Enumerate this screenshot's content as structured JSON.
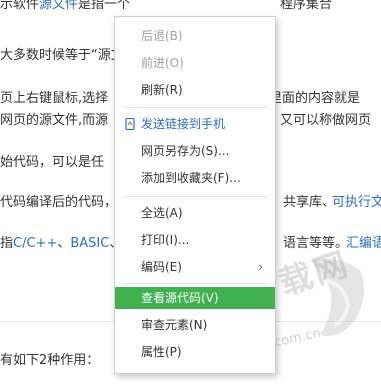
{
  "article": {
    "line1_a": "示软件",
    "line1_link": "源文件",
    "line1_b": "是指一个",
    "line1_c": "程序集合",
    "line2": "大多数时候等于“源文",
    "line3_a": "页上右键鼠标,选择",
    "line3_b": "里面的内容就是",
    "line4_a": "网页的源文件,而源",
    "line4_b": "又可以称做网页",
    "line5": "始代码，可以是任",
    "line6_a": "代码编译后的代码，",
    "line6_b": "共享库、",
    "line6_link": "可执行文",
    "line7_a": "指",
    "line7_link1": "C/C++",
    "line7_sep": "、",
    "line7_link2": "BASIC",
    "line7_b": "、",
    "line7_c": "语言等等。",
    "line7_link3": "汇编语",
    "bottom_line": "有如下2种作用："
  },
  "context_menu": {
    "items": [
      {
        "label": "后退(B)",
        "disabled": true
      },
      {
        "label": "前进(O)",
        "disabled": true
      },
      {
        "label": "刷新(R)",
        "disabled": false
      },
      {
        "label": "发送链接到手机",
        "disabled": false,
        "icon": "send-to-phone-icon",
        "accent": "#2a6fbf"
      },
      {
        "label": "网页另存为(S)...",
        "disabled": false
      },
      {
        "label": "添加到收藏夹(F)...",
        "disabled": false
      },
      {
        "label": "全选(A)",
        "disabled": false
      },
      {
        "label": "打印(I)...",
        "disabled": false
      },
      {
        "label": "编码(E)",
        "disabled": false,
        "submenu": true
      },
      {
        "label": "查看源代码(V)",
        "disabled": false,
        "highlighted": true
      },
      {
        "label": "审查元素(N)",
        "disabled": false
      },
      {
        "label": "属性(P)",
        "disabled": false
      }
    ],
    "submenu_glyph": "›",
    "highlight_color": "#3fb24f"
  },
  "watermark": {
    "text": "PC下载网",
    "url": "www.pcsoft.com.cn",
    "logo_icon": "pcsoft-logo-icon"
  }
}
